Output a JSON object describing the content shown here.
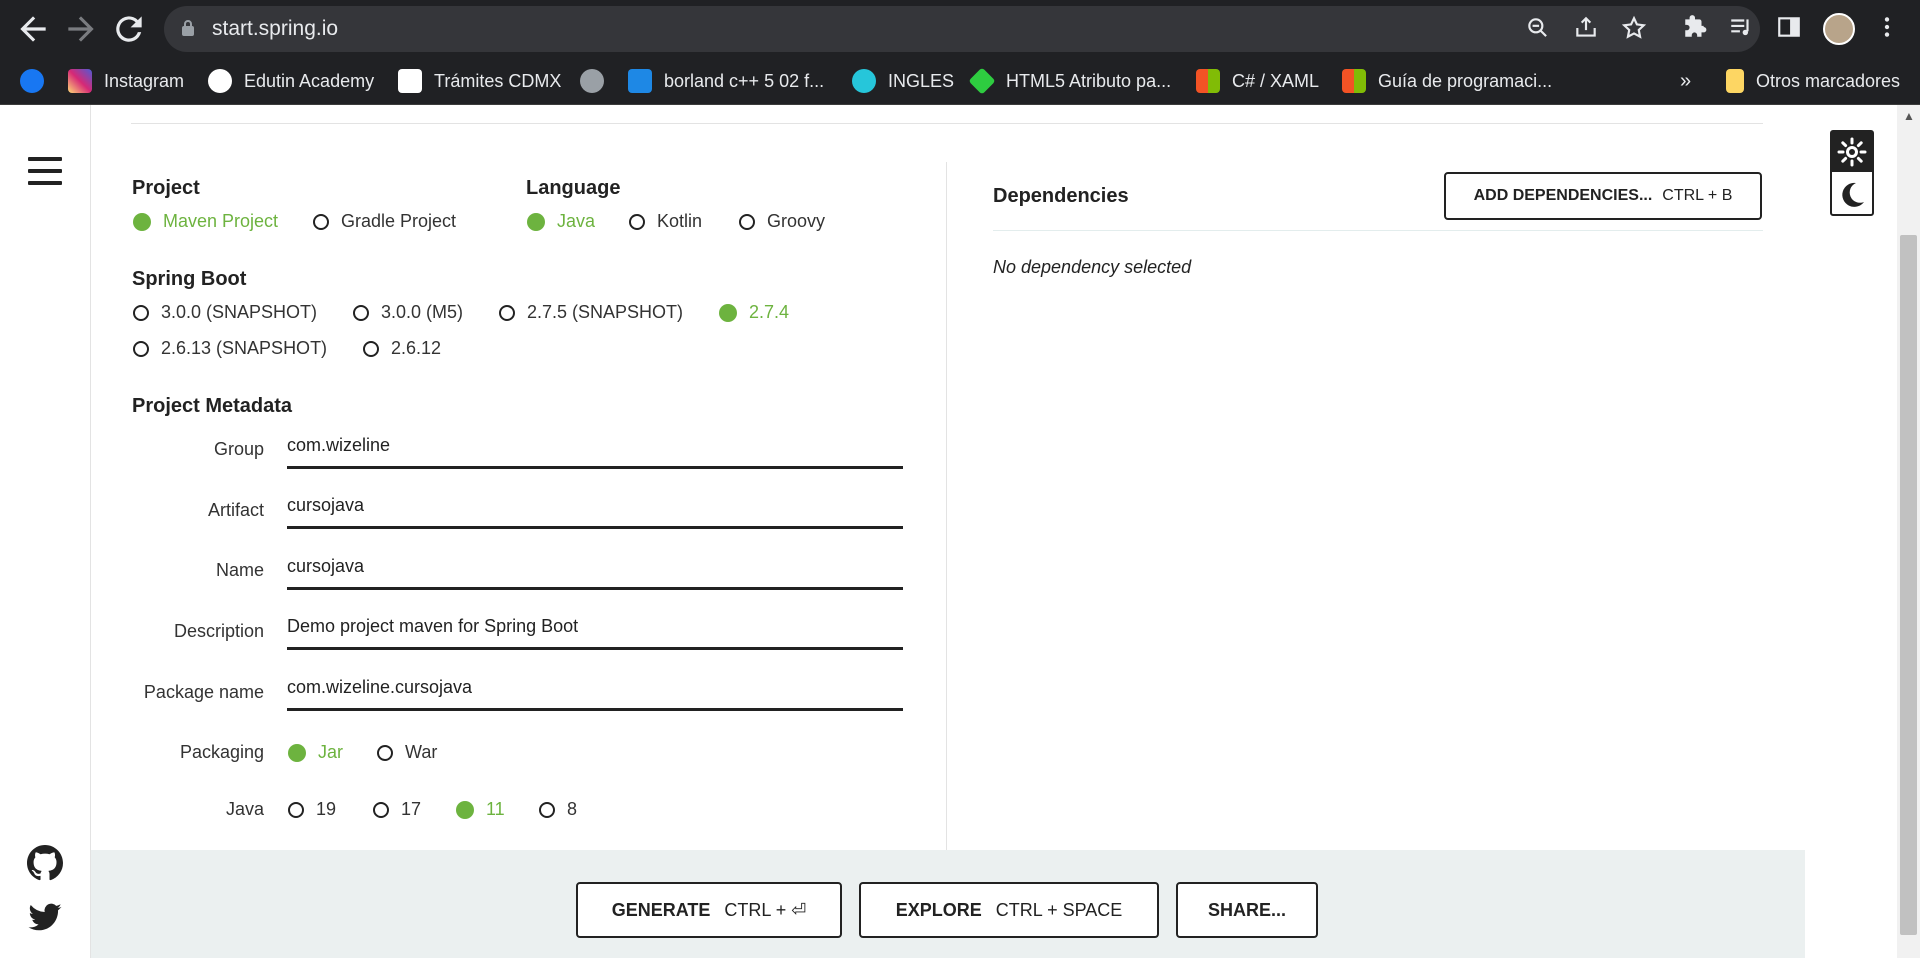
{
  "browser": {
    "url": "start.spring.io",
    "bookmarks": [
      {
        "label": "",
        "icon": "facebook-icon",
        "color": "#1877f2"
      },
      {
        "label": "Instagram",
        "icon": "instagram-icon",
        "color": "#e1306c"
      },
      {
        "label": "Edutin Academy",
        "icon": "edutin-icon",
        "color": "#ffffff"
      },
      {
        "label": "Trámites CDMX",
        "icon": "cdmx-icon",
        "color": "#ffffff"
      },
      {
        "label": "",
        "icon": "globe-icon",
        "color": "#9aa0a6"
      },
      {
        "label": "borland c++ 5 02 f...",
        "icon": "borland-icon",
        "color": "#1e88e5"
      },
      {
        "label": "INGLES",
        "icon": "ingles-icon",
        "color": "#26c6da"
      },
      {
        "label": "HTML5 Atributo pa...",
        "icon": "html5-icon",
        "color": "#2ecc40"
      },
      {
        "label": "C# / XAML",
        "icon": "microsoft-icon",
        "color": "#f35325"
      },
      {
        "label": "Guía de programaci...",
        "icon": "microsoft-icon",
        "color": "#f35325"
      }
    ],
    "more": "»",
    "other_bookmarks": "Otros marcadores"
  },
  "project": {
    "title": "Project",
    "options": [
      {
        "label": "Maven Project",
        "selected": true
      },
      {
        "label": "Gradle Project",
        "selected": false
      }
    ]
  },
  "language": {
    "title": "Language",
    "options": [
      {
        "label": "Java",
        "selected": true
      },
      {
        "label": "Kotlin",
        "selected": false
      },
      {
        "label": "Groovy",
        "selected": false
      }
    ]
  },
  "spring_boot": {
    "title": "Spring Boot",
    "options": [
      {
        "label": "3.0.0 (SNAPSHOT)",
        "selected": false
      },
      {
        "label": "3.0.0 (M5)",
        "selected": false
      },
      {
        "label": "2.7.5 (SNAPSHOT)",
        "selected": false
      },
      {
        "label": "2.7.4",
        "selected": true
      },
      {
        "label": "2.6.13 (SNAPSHOT)",
        "selected": false
      },
      {
        "label": "2.6.12",
        "selected": false
      }
    ]
  },
  "metadata": {
    "title": "Project Metadata",
    "fields": [
      {
        "label": "Group",
        "value": "com.wizeline"
      },
      {
        "label": "Artifact",
        "value": "cursojava"
      },
      {
        "label": "Name",
        "value": "cursojava"
      },
      {
        "label": "Description",
        "value": "Demo project maven for Spring Boot"
      },
      {
        "label": "Package name",
        "value": "com.wizeline.cursojava"
      }
    ],
    "packaging": {
      "label": "Packaging",
      "options": [
        {
          "label": "Jar",
          "selected": true
        },
        {
          "label": "War",
          "selected": false
        }
      ]
    },
    "java": {
      "label": "Java",
      "options": [
        {
          "label": "19",
          "selected": false
        },
        {
          "label": "17",
          "selected": false
        },
        {
          "label": "11",
          "selected": true
        },
        {
          "label": "8",
          "selected": false
        }
      ]
    }
  },
  "dependencies": {
    "title": "Dependencies",
    "add_label": "ADD DEPENDENCIES...",
    "add_shortcut": "CTRL + B",
    "empty": "No dependency selected"
  },
  "footer": {
    "generate_label": "GENERATE",
    "generate_shortcut": "CTRL + ⏎",
    "explore_label": "EXPLORE",
    "explore_shortcut": "CTRL + SPACE",
    "share_label": "SHARE..."
  },
  "colors": {
    "accent": "#6db33f",
    "chrome_bg": "#202124",
    "footer_bg": "#ebf0f0"
  }
}
